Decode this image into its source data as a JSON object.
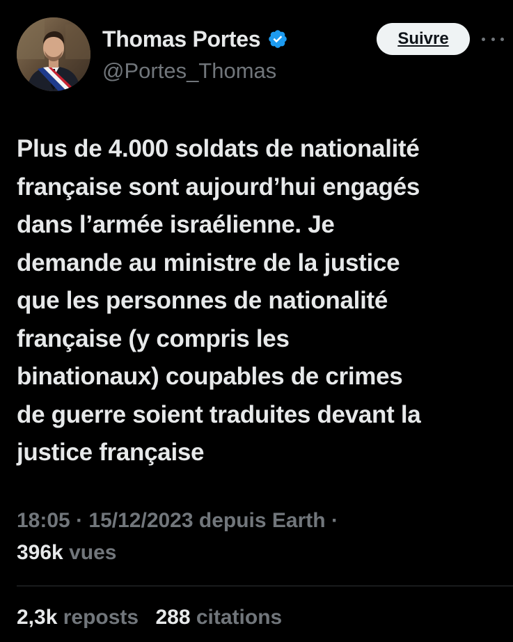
{
  "colors": {
    "background": "#000000",
    "text_primary": "#e7e9ea",
    "text_secondary": "#71767b",
    "verified_badge": "#1d9bf0",
    "follow_button_bg": "#eff3f4",
    "divider": "#2f3336"
  },
  "author": {
    "display_name": "Thomas Portes",
    "handle": "@Portes_Thomas",
    "verified_icon": "verified-badge-icon",
    "avatar_icon": "profile-photo"
  },
  "actions": {
    "follow_label": "Suivre",
    "more_icon": "more-horizontal-icon"
  },
  "tweet": {
    "text": "Plus de 4.000 soldats de nationalité\nfrançaise sont aujourd’hui engagés\ndans l’armée israélienne. Je\ndemande au ministre de la justice\nque les personnes de nationalité\nfrançaise (y compris les\nbinationaux) coupables de crimes\nde guerre soient traduites devant la\njustice française"
  },
  "meta": {
    "time": "18:05",
    "separator_1": " · ",
    "date": "15/12/2023",
    "source": " depuis Earth",
    "separator_2": " ·",
    "views_count": "396k",
    "views_label": " vues"
  },
  "stats": {
    "reposts_count": "2,3k",
    "reposts_label": " reposts",
    "quotes_count": "288",
    "quotes_label": " citations"
  }
}
